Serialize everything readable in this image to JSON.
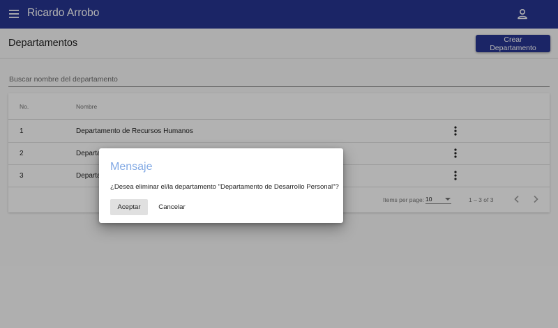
{
  "app": {
    "title": "Ricardo Arrobo",
    "brand_color": "#283593"
  },
  "page": {
    "title": "Departamentos",
    "create_label": "Crear Departamento"
  },
  "search": {
    "placeholder": "Buscar nombre del departamento",
    "value": ""
  },
  "table": {
    "columns": [
      "No.",
      "Nombre"
    ],
    "rows": [
      {
        "no": "1",
        "name": "Departamento de Recursos Humanos"
      },
      {
        "no": "2",
        "name": "Departa"
      },
      {
        "no": "3",
        "name": "Departa"
      }
    ]
  },
  "paginator": {
    "items_label": "Items per page:",
    "page_size": "10",
    "range": "1 – 3 of 3"
  },
  "dialog": {
    "title": "Mensaje",
    "message": "¿Desea eliminar el/la departamento \"Departamento de Desarrollo Personal\"?",
    "accept_label": "Aceptar",
    "cancel_label": "Cancelar",
    "title_color": "#82a9e4"
  },
  "icons": {
    "menu": "menu-icon",
    "account": "account-icon",
    "row_actions": "more-vert-icon",
    "prev": "chevron-left-icon",
    "next": "chevron-right-icon"
  }
}
